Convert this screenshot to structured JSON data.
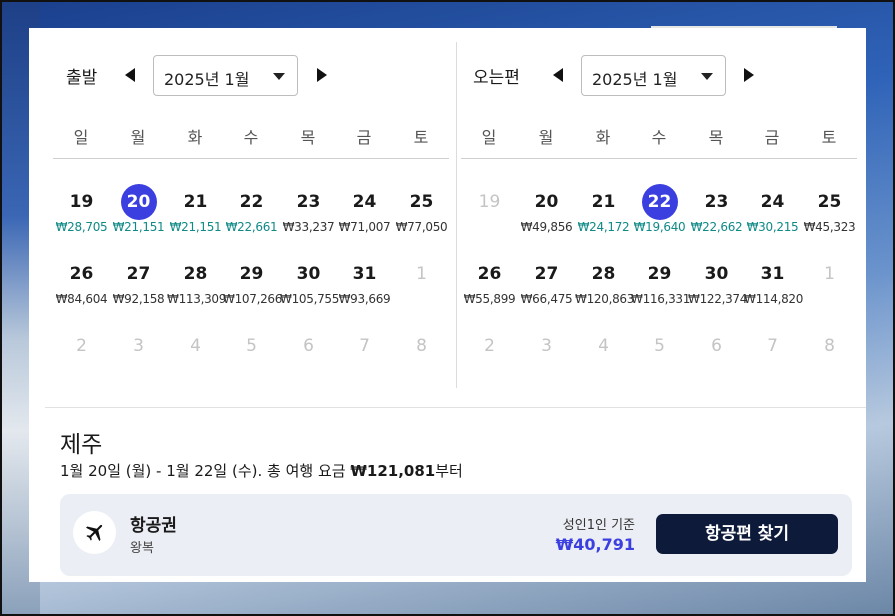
{
  "left_calendar": {
    "title": "출발",
    "month": "2025년 1월",
    "weekdays": [
      "일",
      "월",
      "화",
      "수",
      "목",
      "금",
      "토"
    ],
    "weeks": [
      [
        {
          "day": "19",
          "price": "₩28,705",
          "low": true
        },
        {
          "day": "20",
          "price": "₩21,151",
          "low": true,
          "selected": true
        },
        {
          "day": "21",
          "price": "₩21,151",
          "low": true
        },
        {
          "day": "22",
          "price": "₩22,661",
          "low": true
        },
        {
          "day": "23",
          "price": "₩33,237"
        },
        {
          "day": "24",
          "price": "₩71,007"
        },
        {
          "day": "25",
          "price": "₩77,050"
        }
      ],
      [
        {
          "day": "26",
          "price": "₩84,604"
        },
        {
          "day": "27",
          "price": "₩92,158"
        },
        {
          "day": "28",
          "price": "₩113,309"
        },
        {
          "day": "29",
          "price": "₩107,266"
        },
        {
          "day": "30",
          "price": "₩105,755"
        },
        {
          "day": "31",
          "price": "₩93,669"
        },
        {
          "day": "1",
          "muted": true
        }
      ],
      [
        {
          "day": "2",
          "muted": true
        },
        {
          "day": "3",
          "muted": true
        },
        {
          "day": "4",
          "muted": true
        },
        {
          "day": "5",
          "muted": true
        },
        {
          "day": "6",
          "muted": true
        },
        {
          "day": "7",
          "muted": true
        },
        {
          "day": "8",
          "muted": true
        }
      ]
    ]
  },
  "right_calendar": {
    "title": "오는편",
    "month": "2025년 1월",
    "weekdays": [
      "일",
      "월",
      "화",
      "수",
      "목",
      "금",
      "토"
    ],
    "weeks": [
      [
        {
          "day": "19",
          "muted": true
        },
        {
          "day": "20",
          "price": "₩49,856"
        },
        {
          "day": "21",
          "price": "₩24,172",
          "low": true
        },
        {
          "day": "22",
          "price": "₩19,640",
          "low": true,
          "selected": true
        },
        {
          "day": "23",
          "price": "₩22,662",
          "low": true
        },
        {
          "day": "24",
          "price": "₩30,215",
          "low": true
        },
        {
          "day": "25",
          "price": "₩45,323"
        }
      ],
      [
        {
          "day": "26",
          "price": "₩55,899"
        },
        {
          "day": "27",
          "price": "₩66,475"
        },
        {
          "day": "28",
          "price": "₩120,863"
        },
        {
          "day": "29",
          "price": "₩116,331"
        },
        {
          "day": "30",
          "price": "₩122,374"
        },
        {
          "day": "31",
          "price": "₩114,820"
        },
        {
          "day": "1",
          "muted": true
        }
      ],
      [
        {
          "day": "2",
          "muted": true
        },
        {
          "day": "3",
          "muted": true
        },
        {
          "day": "4",
          "muted": true
        },
        {
          "day": "5",
          "muted": true
        },
        {
          "day": "6",
          "muted": true
        },
        {
          "day": "7",
          "muted": true
        },
        {
          "day": "8",
          "muted": true
        }
      ]
    ]
  },
  "destination": "제주",
  "summary": {
    "dates": "1월 20일 (월) - 1월 22일 (수).",
    "fare_label": "총 여행 요금",
    "fare_value": "₩121,081",
    "suffix": "부터"
  },
  "flight_card": {
    "icon": "airplane-icon",
    "title": "항공권",
    "subtitle": "왕복",
    "basis": "성인1인 기준",
    "price": "₩40,791",
    "button_label": "항공편 찾기"
  },
  "colors": {
    "accent": "#3b3fe0",
    "low_price": "#0f8a86",
    "button_bg": "#0e1a3a"
  }
}
